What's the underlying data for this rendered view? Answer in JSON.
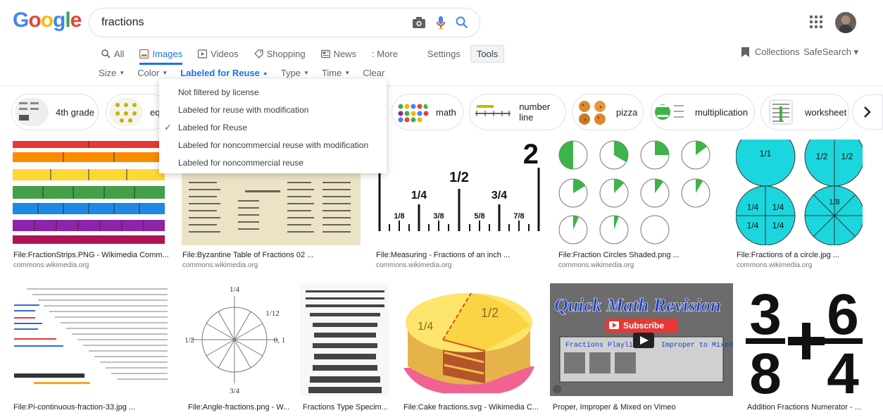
{
  "search": {
    "query": "fractions"
  },
  "logo": [
    "G",
    "o",
    "o",
    "g",
    "l",
    "e"
  ],
  "tabs": [
    {
      "label": "All",
      "icon": "search-icon"
    },
    {
      "label": "Images",
      "icon": "image-icon",
      "active": true
    },
    {
      "label": "Videos",
      "icon": "play-icon"
    },
    {
      "label": "Shopping",
      "icon": "tag-icon"
    },
    {
      "label": "News",
      "icon": "news-icon"
    },
    {
      "label": ": More",
      "icon": "more-icon"
    }
  ],
  "settings_label": "Settings",
  "tools_label": "Tools",
  "collections_label": "Collections",
  "safesearch_label": "SafeSearch ▾",
  "filters": [
    {
      "label": "Size"
    },
    {
      "label": "Color"
    },
    {
      "label": "Labeled for Reuse",
      "active": true,
      "caret": "▲"
    },
    {
      "label": "Type"
    },
    {
      "label": "Time"
    },
    {
      "label": "Clear"
    }
  ],
  "license_menu": {
    "items": [
      "Not filtered by license",
      "Labeled for reuse with modification",
      "Labeled for Reuse",
      "Labeled for noncommercial reuse with modification",
      "Labeled for noncommercial reuse"
    ],
    "selected_index": 2
  },
  "chips": [
    "4th grade",
    "equ",
    "math",
    "number line",
    "pizza",
    "multiplication",
    "worksheet"
  ],
  "results_row1": [
    {
      "title": "File:FractionStrips.PNG - Wikimedia Comm...",
      "domain": "commons.wikimedia.org"
    },
    {
      "title": "File:Byzantine Table of Fractions 02 ...",
      "domain": "commons.wikimedia.org"
    },
    {
      "title": "File:Measuring - Fractions of an inch ...",
      "domain": "commons.wikimedia.org"
    },
    {
      "title": "File:Fraction Circles Shaded.png ...",
      "domain": "commons.wikimedia.org"
    },
    {
      "title": "File:Fractions of a circle.jpg ...",
      "domain": "commons.wikimedia.org"
    }
  ],
  "results_row2": [
    {
      "title": "File:Pi-continuous-fraction-33.jpg ..."
    },
    {
      "title": "File:Angle-fractions.png - W..."
    },
    {
      "title": "Fractions Type Specim..."
    },
    {
      "title": "File:Cake fractions.svg - Wikimedia C..."
    },
    {
      "title": "Proper, Improper & Mixed on Vimeo"
    },
    {
      "title": "Addition Fractions Numerator - ..."
    }
  ],
  "image_text": {
    "ruler_marks": [
      "1/2",
      "1/4",
      "3/4",
      "1/8",
      "3/8",
      "5/8",
      "7/8",
      "2"
    ],
    "circle_labels": [
      "1/1",
      "1/2",
      "1/2",
      "1/4",
      "1/4",
      "1/4",
      "1/4",
      "1/8"
    ],
    "cake_labels": [
      "1/4",
      "1/2"
    ],
    "vimeo_title": "Quick Math Revision",
    "vimeo_subscribe": "Subscribe",
    "vimeo_playlist": "Fractions Playlist",
    "vimeo_improper": "Improper to Mixed",
    "addition": [
      "3",
      "8",
      "6",
      "4"
    ],
    "angle_labels": [
      "1/4",
      "1/12",
      "1/2",
      "0, 1",
      "3/4"
    ]
  },
  "colors": {
    "accent": "#1a73e8",
    "chip_border": "#dfe1e5",
    "cyan": "#1bd6dc",
    "green": "#3db34a"
  }
}
